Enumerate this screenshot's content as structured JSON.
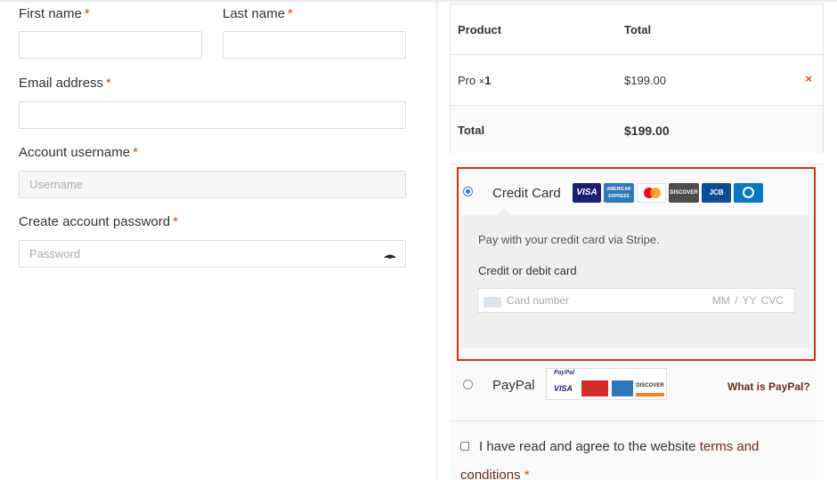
{
  "form": {
    "first_name_label": "First name",
    "last_name_label": "Last name",
    "email_label": "Email address",
    "username_label": "Account username",
    "username_placeholder": "Username",
    "password_label": "Create account password",
    "password_placeholder": "Password",
    "required_mark": "*"
  },
  "order": {
    "col_product": "Product",
    "col_total": "Total",
    "item_name": "Pro",
    "item_qty_sep": "×",
    "item_qty": "1",
    "item_price": "$199.00",
    "remove_icon": "×",
    "total_label": "Total",
    "total_value": "$199.00"
  },
  "payment": {
    "credit_card_label": "Credit Card",
    "card_brands": [
      "visa",
      "american-express",
      "mastercard",
      "discover",
      "jcb",
      "diners-club"
    ],
    "stripe_desc": "Pay with your credit card via Stripe.",
    "card_field_label": "Credit or debit card",
    "card_number_placeholder": "Card number",
    "expiry_cvc_placeholder": "MM / YY  CVC",
    "paypal_label": "PayPal",
    "what_is_paypal": "What is PayPal?",
    "paypal_logo_text": "PayPal"
  },
  "terms": {
    "text": "I have read and agree to the website",
    "link1": "terms and",
    "link2": "conditions",
    "required_mark": "*"
  },
  "colors": {
    "required": "#e2401c",
    "highlight_box": "#d0301b",
    "link": "#6b2b1d",
    "radio_selected": "#3b6fd6"
  }
}
